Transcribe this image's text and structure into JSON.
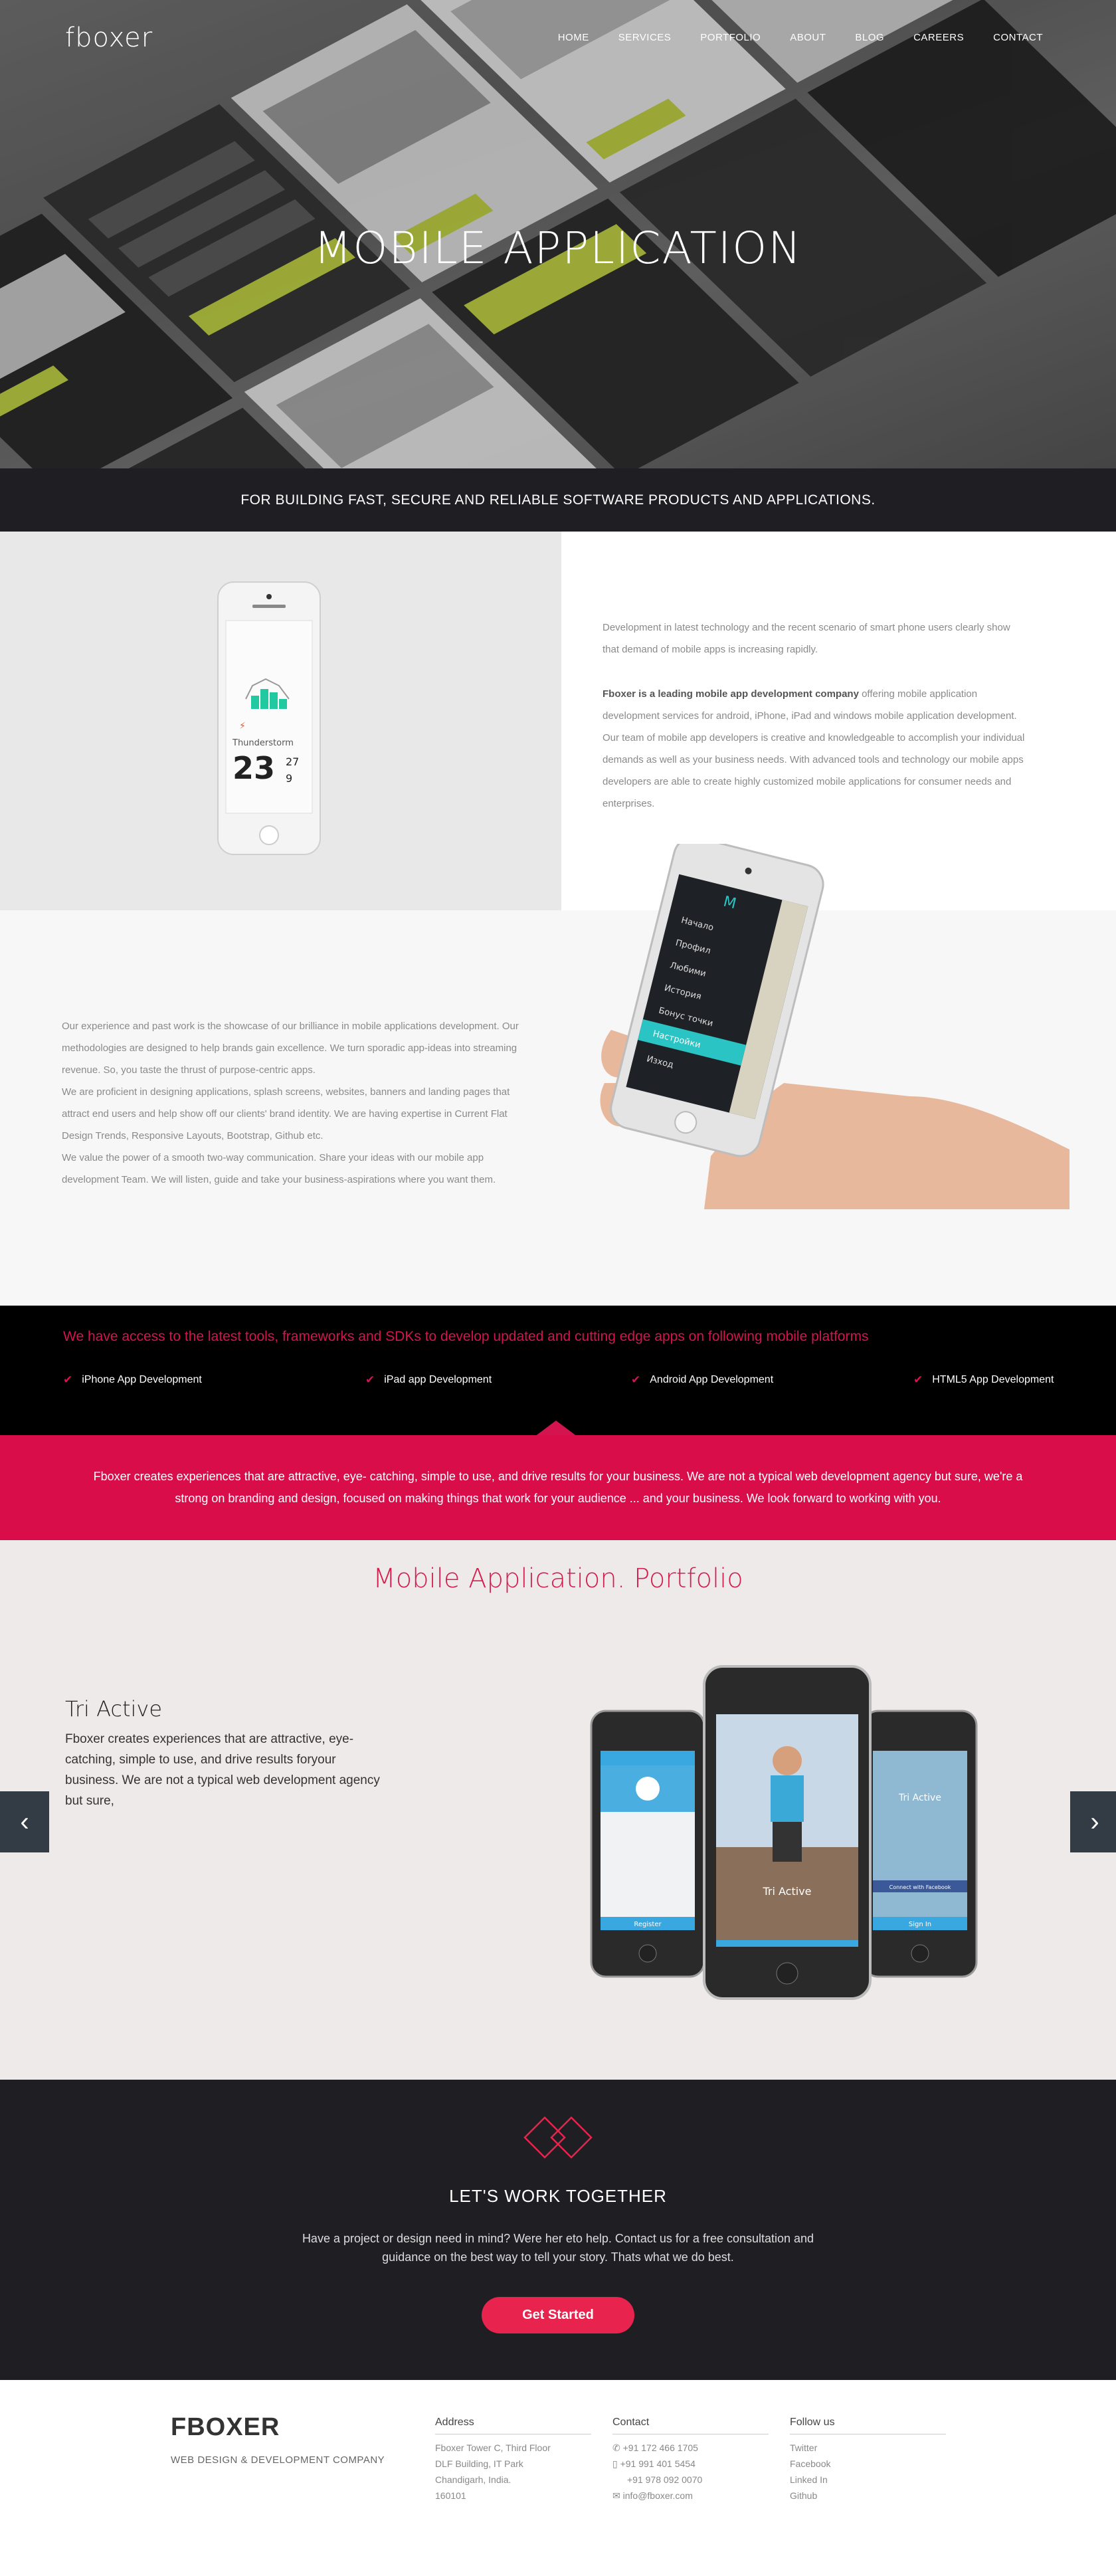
{
  "header": {
    "logo": "fboxer",
    "nav": [
      "HOME",
      "SERVICES",
      "PORTFOLIO",
      "ABOUT",
      "BLOG",
      "CAREERS",
      "CONTACT"
    ]
  },
  "hero": {
    "title": "MOBILE APPLICATION",
    "tagline": "FOR BUILDING FAST, SECURE AND RELIABLE SOFTWARE PRODUCTS AND APPLICATIONS."
  },
  "about1": {
    "para1": "Development in latest technology and the recent scenario of smart phone users clearly show that demand of mobile apps is increasing rapidly.",
    "para2_bold": "Fboxer is a leading mobile app development company",
    "para2_rest": " offering mobile application development services for android, iPhone, iPad and windows mobile application development. Our team of mobile app developers is creative and knowledgeable to accomplish your individual demands as well as your business needs. With advanced tools and technology our mobile apps developers are able to create highly customized mobile applications for consumer needs and enterprises.",
    "weather_label": "Thunderstorm",
    "weather_temp": "23",
    "weather_hi": "27",
    "weather_lo": "9"
  },
  "about2": {
    "para1": "Our experience and past work is the showcase of our brilliance in mobile applications development. Our methodologies are designed to help brands gain excellence. We turn sporadic app-ideas into streaming revenue. So, you taste the thrust of purpose-centric apps.",
    "para2": "We are proficient in designing applications, splash screens, websites, banners and landing pages that attract end users and help show off our clients' brand identity. We are having expertise in Current Flat Design Trends, Responsive Layouts, Bootstrap, Github etc.",
    "para3": "We value the power of a smooth two-way communication. Share your ideas with our mobile app development Team. We will listen, guide and take your business-aspirations where you want them.",
    "menu_header": "M",
    "menu_items": [
      "Начало",
      "Профил",
      "Любими",
      "История",
      "Бонус точки",
      "Настройки",
      "Изход"
    ]
  },
  "platforms": {
    "heading": "We have access to the latest tools, frameworks and SDKs to develop updated and cutting edge apps on following mobile platforms",
    "items": [
      "iPhone App Development",
      "iPad app Development",
      "Android App Development",
      "HTML5 App Development"
    ]
  },
  "pinkbar": {
    "text": "Fboxer creates experiences that are attractive, eye- catching, simple to use, and drive results for your business. We are not a typical web development agency but sure, we're a strong on branding and design, focused on making things that work for your audience ... and your business. We look forward to working with you."
  },
  "portfolio": {
    "title": "Mobile Application. Portfolio",
    "slide_title": "Tri Active",
    "slide_desc": "Fboxer creates experiences that are attractive, eye- catching, simple to use, and drive results foryour business. We are not a typical web development agency but sure,",
    "phone_app_name": "Tri Active",
    "register_label": "Register",
    "sign_in_label": "Sign In",
    "facebook_label": "Connect with Facebook",
    "prev_icon": "chevron-left-icon",
    "next_icon": "chevron-right-icon"
  },
  "cta": {
    "title": "LET'S WORK TOGETHER",
    "desc": "Have a project or design need in mind? Were her eto help. Contact us for a free consultation and guidance on the best way to tell your story. Thats what we do best.",
    "button": "Get Started"
  },
  "footer": {
    "brand": "FBOXER",
    "sub": "WEB DESIGN & DEVELOPMENT COMPANY",
    "address_heading": "Address",
    "address_lines": [
      "Fboxer Tower C, Third Floor",
      "DLF Building, IT Park",
      "Chandigarh, India.",
      "160101"
    ],
    "contact_heading": "Contact",
    "contact_lines": [
      "+91 172 466 1705",
      "+91 991 401 5454",
      "+91 978 092 0070",
      "info@fboxer.com"
    ],
    "follow_heading": "Follow us",
    "follow_links": [
      "Twitter",
      "Facebook",
      "Linked In",
      "Github"
    ]
  },
  "colors": {
    "accent": "#d90d4a",
    "dark": "#1f1f23",
    "teal": "#2bc4c4"
  }
}
